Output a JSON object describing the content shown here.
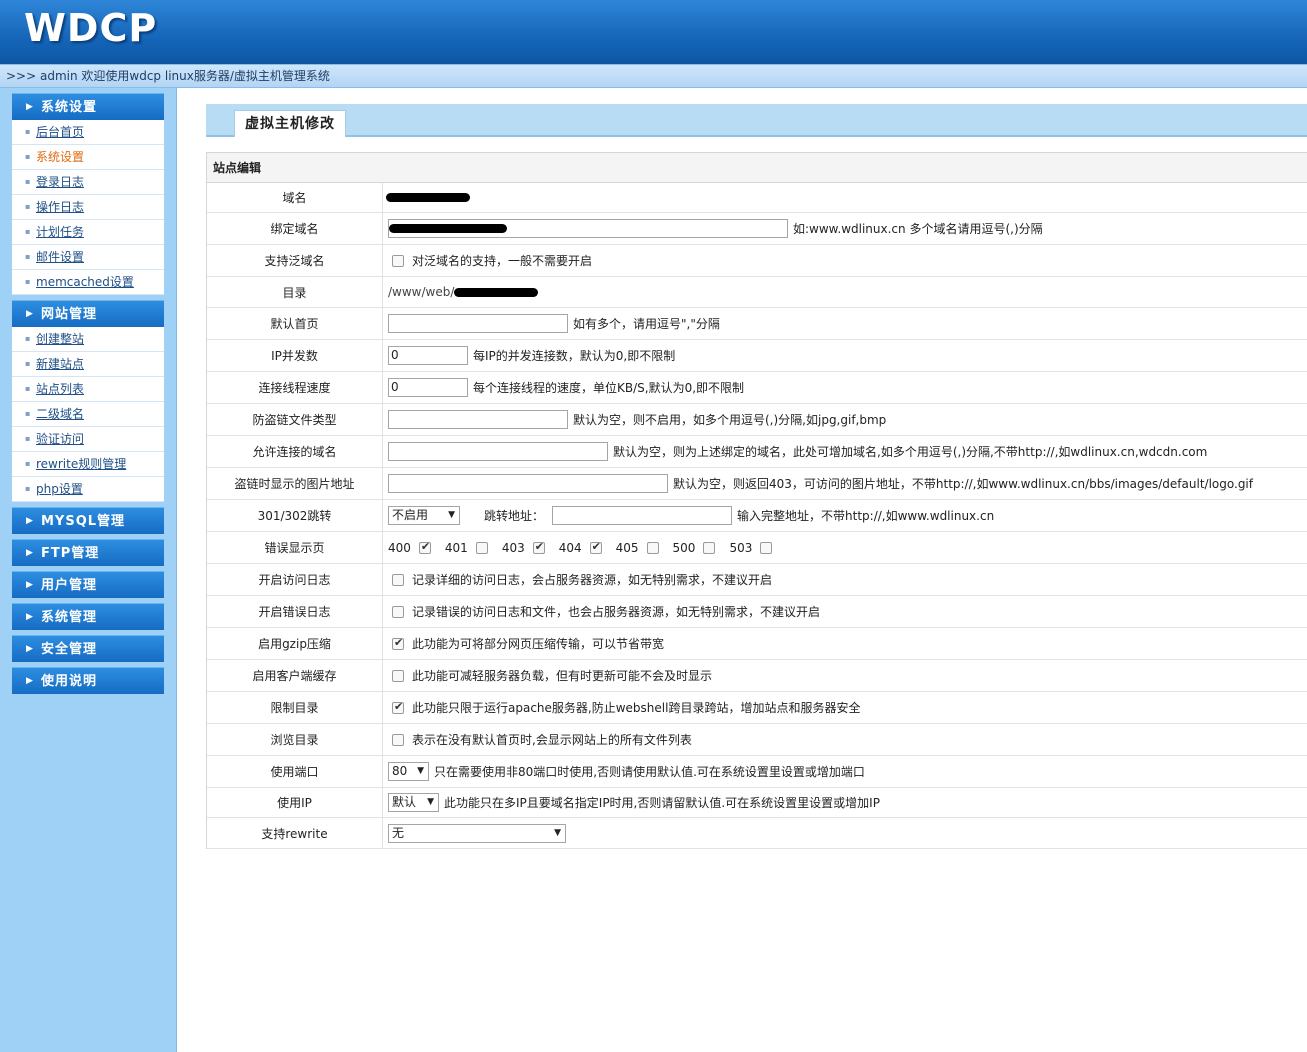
{
  "header": {
    "logo": "WDCP"
  },
  "breadcrumb": ">>> admin 欢迎使用wdcp linux服务器/虚拟主机管理系统",
  "sidebar": {
    "sections": [
      {
        "title": "系统设置",
        "items": [
          "后台首页",
          "系统设置",
          "登录日志",
          "操作日志",
          "计划任务",
          "邮件设置",
          "memcached设置"
        ]
      },
      {
        "title": "网站管理",
        "items": [
          "创建整站",
          "新建站点",
          "站点列表",
          "二级域名",
          "验证访问",
          "rewrite规则管理",
          "php设置"
        ]
      },
      {
        "title": "MYSQL管理",
        "items": []
      },
      {
        "title": "FTP管理",
        "items": []
      },
      {
        "title": "用户管理",
        "items": []
      },
      {
        "title": "系统管理",
        "items": []
      },
      {
        "title": "安全管理",
        "items": []
      },
      {
        "title": "使用说明",
        "items": []
      }
    ],
    "active_item": "系统设置"
  },
  "tab": {
    "title": "虚拟主机修改"
  },
  "form": {
    "section_title": "站点编辑",
    "domain": {
      "label": "域名"
    },
    "bind_domain": {
      "label": "绑定域名",
      "value": "",
      "hint": "如:www.wdlinux.cn 多个域名请用逗号(,)分隔"
    },
    "wildcard": {
      "label": "支持泛域名",
      "checked": false,
      "hint": "对泛域名的支持，一般不需要开启"
    },
    "directory": {
      "label": "目录",
      "value": "/www/web/"
    },
    "default_page": {
      "label": "默认首页",
      "value": "",
      "hint": "如有多个，请用逗号\",\"分隔"
    },
    "ip_concurrency": {
      "label": "IP并发数",
      "value": "0",
      "hint": "每IP的并发连接数，默认为0,即不限制"
    },
    "thread_speed": {
      "label": "连接线程速度",
      "value": "0",
      "hint": "每个连接线程的速度，单位KB/S,默认为0,即不限制"
    },
    "hotlink_types": {
      "label": "防盗链文件类型",
      "value": "",
      "hint": "默认为空，则不启用，如多个用逗号(,)分隔,如jpg,gif,bmp"
    },
    "allowed_domains": {
      "label": "允许连接的域名",
      "value": "",
      "hint": "默认为空，则为上述绑定的域名，此处可增加域名,如多个用逗号(,)分隔,不带http://,如wdlinux.cn,wdcdn.com"
    },
    "hotlink_image": {
      "label": "盗链时显示的图片地址",
      "value": "",
      "hint": "默认为空，则返回403，可访问的图片地址，不带http://,如www.wdlinux.cn/bbs/images/default/logo.gif"
    },
    "redirect": {
      "label": "301/302跳转",
      "select": "不启用",
      "addr_label": "跳转地址：",
      "value": "",
      "hint": "输入完整地址，不带http://,如www.wdlinux.cn"
    },
    "error_pages": {
      "label": "错误显示页",
      "codes": [
        {
          "code": "400",
          "checked": true
        },
        {
          "code": "401",
          "checked": false
        },
        {
          "code": "403",
          "checked": true
        },
        {
          "code": "404",
          "checked": true
        },
        {
          "code": "405",
          "checked": false
        },
        {
          "code": "500",
          "checked": false
        },
        {
          "code": "503",
          "checked": false
        }
      ]
    },
    "access_log": {
      "label": "开启访问日志",
      "checked": false,
      "hint": "记录详细的访问日志，会占服务器资源，如无特别需求，不建议开启"
    },
    "error_log": {
      "label": "开启错误日志",
      "checked": false,
      "hint": "记录错误的访问日志和文件，也会占服务器资源，如无特别需求，不建议开启"
    },
    "gzip": {
      "label": "启用gzip压缩",
      "checked": true,
      "hint": "此功能为可将部分网页压缩传输，可以节省带宽"
    },
    "client_cache": {
      "label": "启用客户端缓存",
      "checked": false,
      "hint": "此功能可减轻服务器负载，但有时更新可能不会及时显示"
    },
    "restrict_dir": {
      "label": "限制目录",
      "checked": true,
      "hint": "此功能只限于运行apache服务器,防止webshell跨目录跨站，增加站点和服务器安全"
    },
    "browse_dir": {
      "label": "浏览目录",
      "checked": false,
      "hint": "表示在没有默认首页时,会显示网站上的所有文件列表"
    },
    "port": {
      "label": "使用端口",
      "select": "80",
      "hint": "只在需要使用非80端口时使用,否则请使用默认值.可在系统设置里设置或增加端口"
    },
    "ip": {
      "label": "使用IP",
      "select": "默认",
      "hint": "此功能只在多IP且要域名指定IP时用,否则请留默认值.可在系统设置里设置或增加IP"
    },
    "rewrite": {
      "label": "支持rewrite",
      "select": "无"
    }
  },
  "colors": {
    "header_blue": "#1565b8",
    "sidebar_bg": "#9fd1f7",
    "active_orange": "#e06a10"
  }
}
